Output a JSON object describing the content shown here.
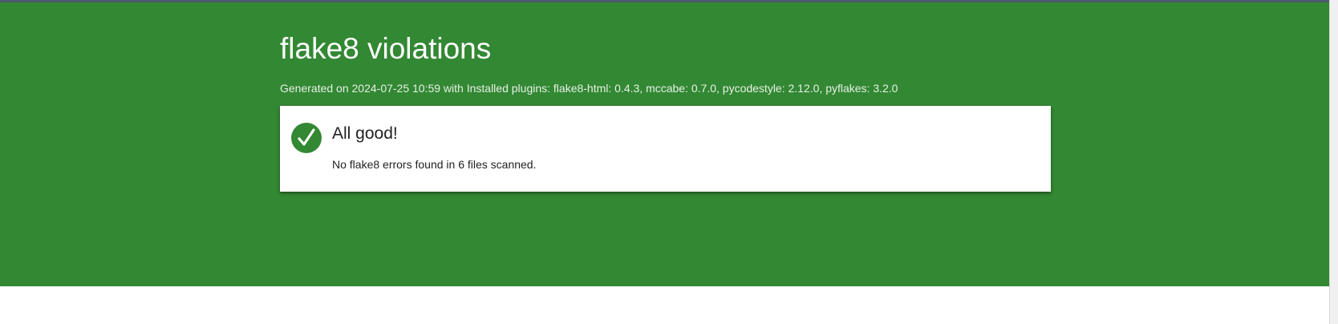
{
  "report": {
    "title": "flake8 violations",
    "generated_line": "Generated on 2024-07-25 10:59 with Installed plugins: flake8-html: 0.4.3, mccabe: 0.7.0, pycodestyle: 2.12.0, pyflakes: 3.2.0"
  },
  "result": {
    "icon": "checkmark-icon",
    "heading": "All good!",
    "detail": "No flake8 errors found in 6 files scanned."
  },
  "colors": {
    "header_green": "#338833",
    "card_background": "#ffffff",
    "text_dark": "#222222"
  }
}
